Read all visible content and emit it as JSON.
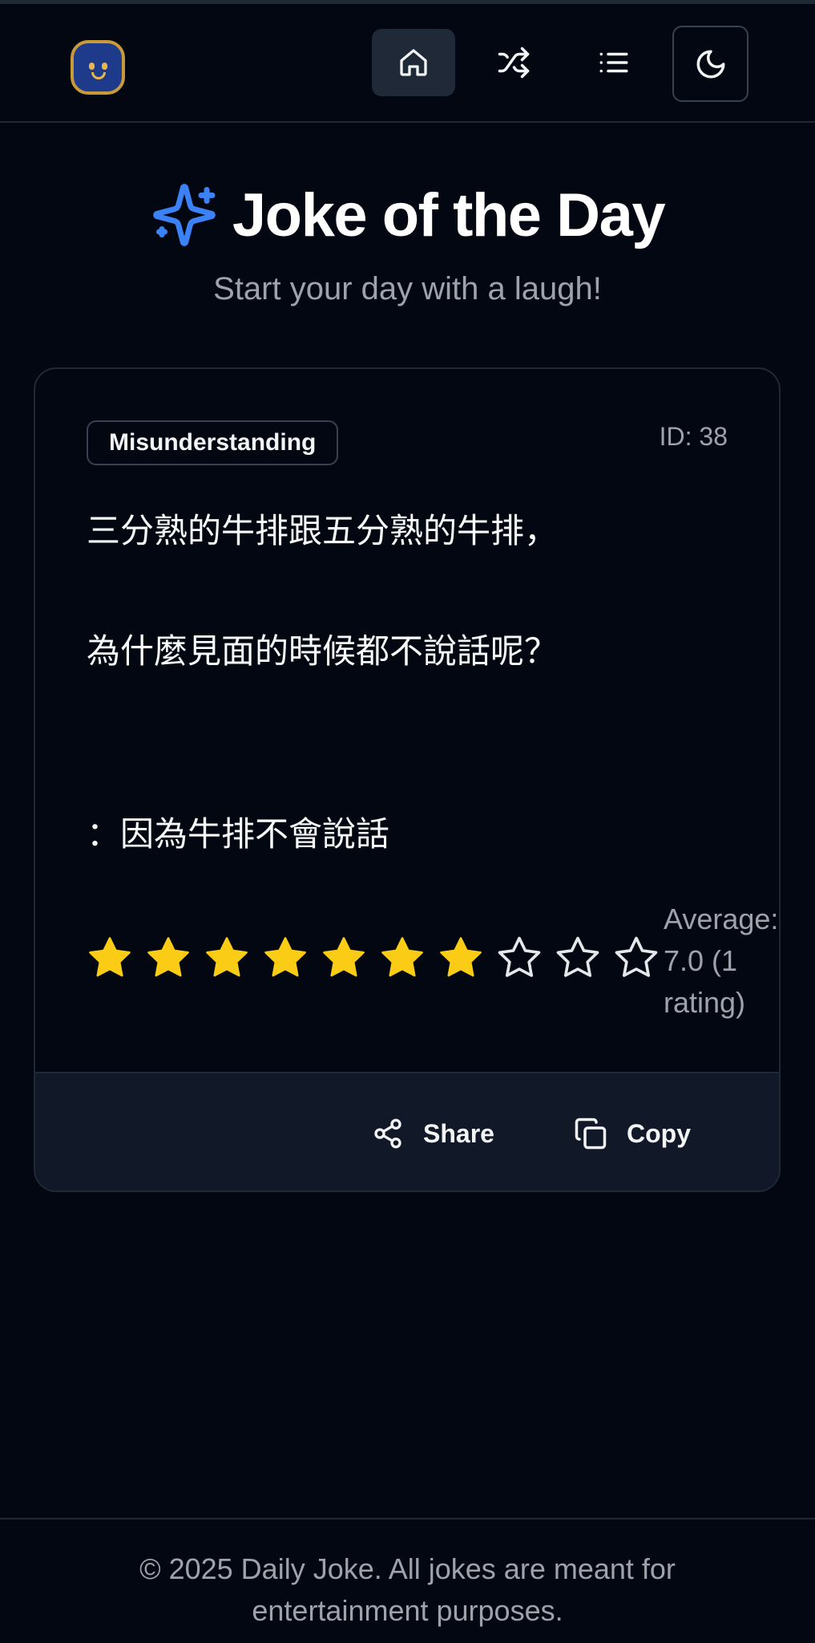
{
  "nav": {
    "logo": "smiley-logo",
    "items": [
      {
        "name": "home",
        "icon": "home-icon",
        "active": true
      },
      {
        "name": "random",
        "icon": "shuffle-icon",
        "active": false
      },
      {
        "name": "list",
        "icon": "list-icon",
        "active": false
      }
    ],
    "theme_icon": "moon-icon"
  },
  "hero": {
    "icon": "sparkles-icon",
    "title": "Joke of the Day",
    "subtitle": "Start your day with a laugh!"
  },
  "joke": {
    "category": "Misunderstanding",
    "id_label": "ID: 38",
    "question_line1": "三分熟的牛排跟五分熟的牛排，",
    "question_line2": "為什麼見面的時候都不說話呢？",
    "answer": "：因為牛排不會說話",
    "rating": {
      "filled_stars": 7,
      "max_stars": 10,
      "average_label": "Average: 7.0 (1 rating)"
    }
  },
  "actions": {
    "share_label": "Share",
    "copy_label": "Copy"
  },
  "footer": {
    "copyright": "© 2025 Daily Joke. All jokes are meant for entertainment purposes."
  },
  "colors": {
    "background": "#030712",
    "accent": "#3b82f6",
    "star": "#facc15",
    "muted_text": "#9ca3af"
  }
}
